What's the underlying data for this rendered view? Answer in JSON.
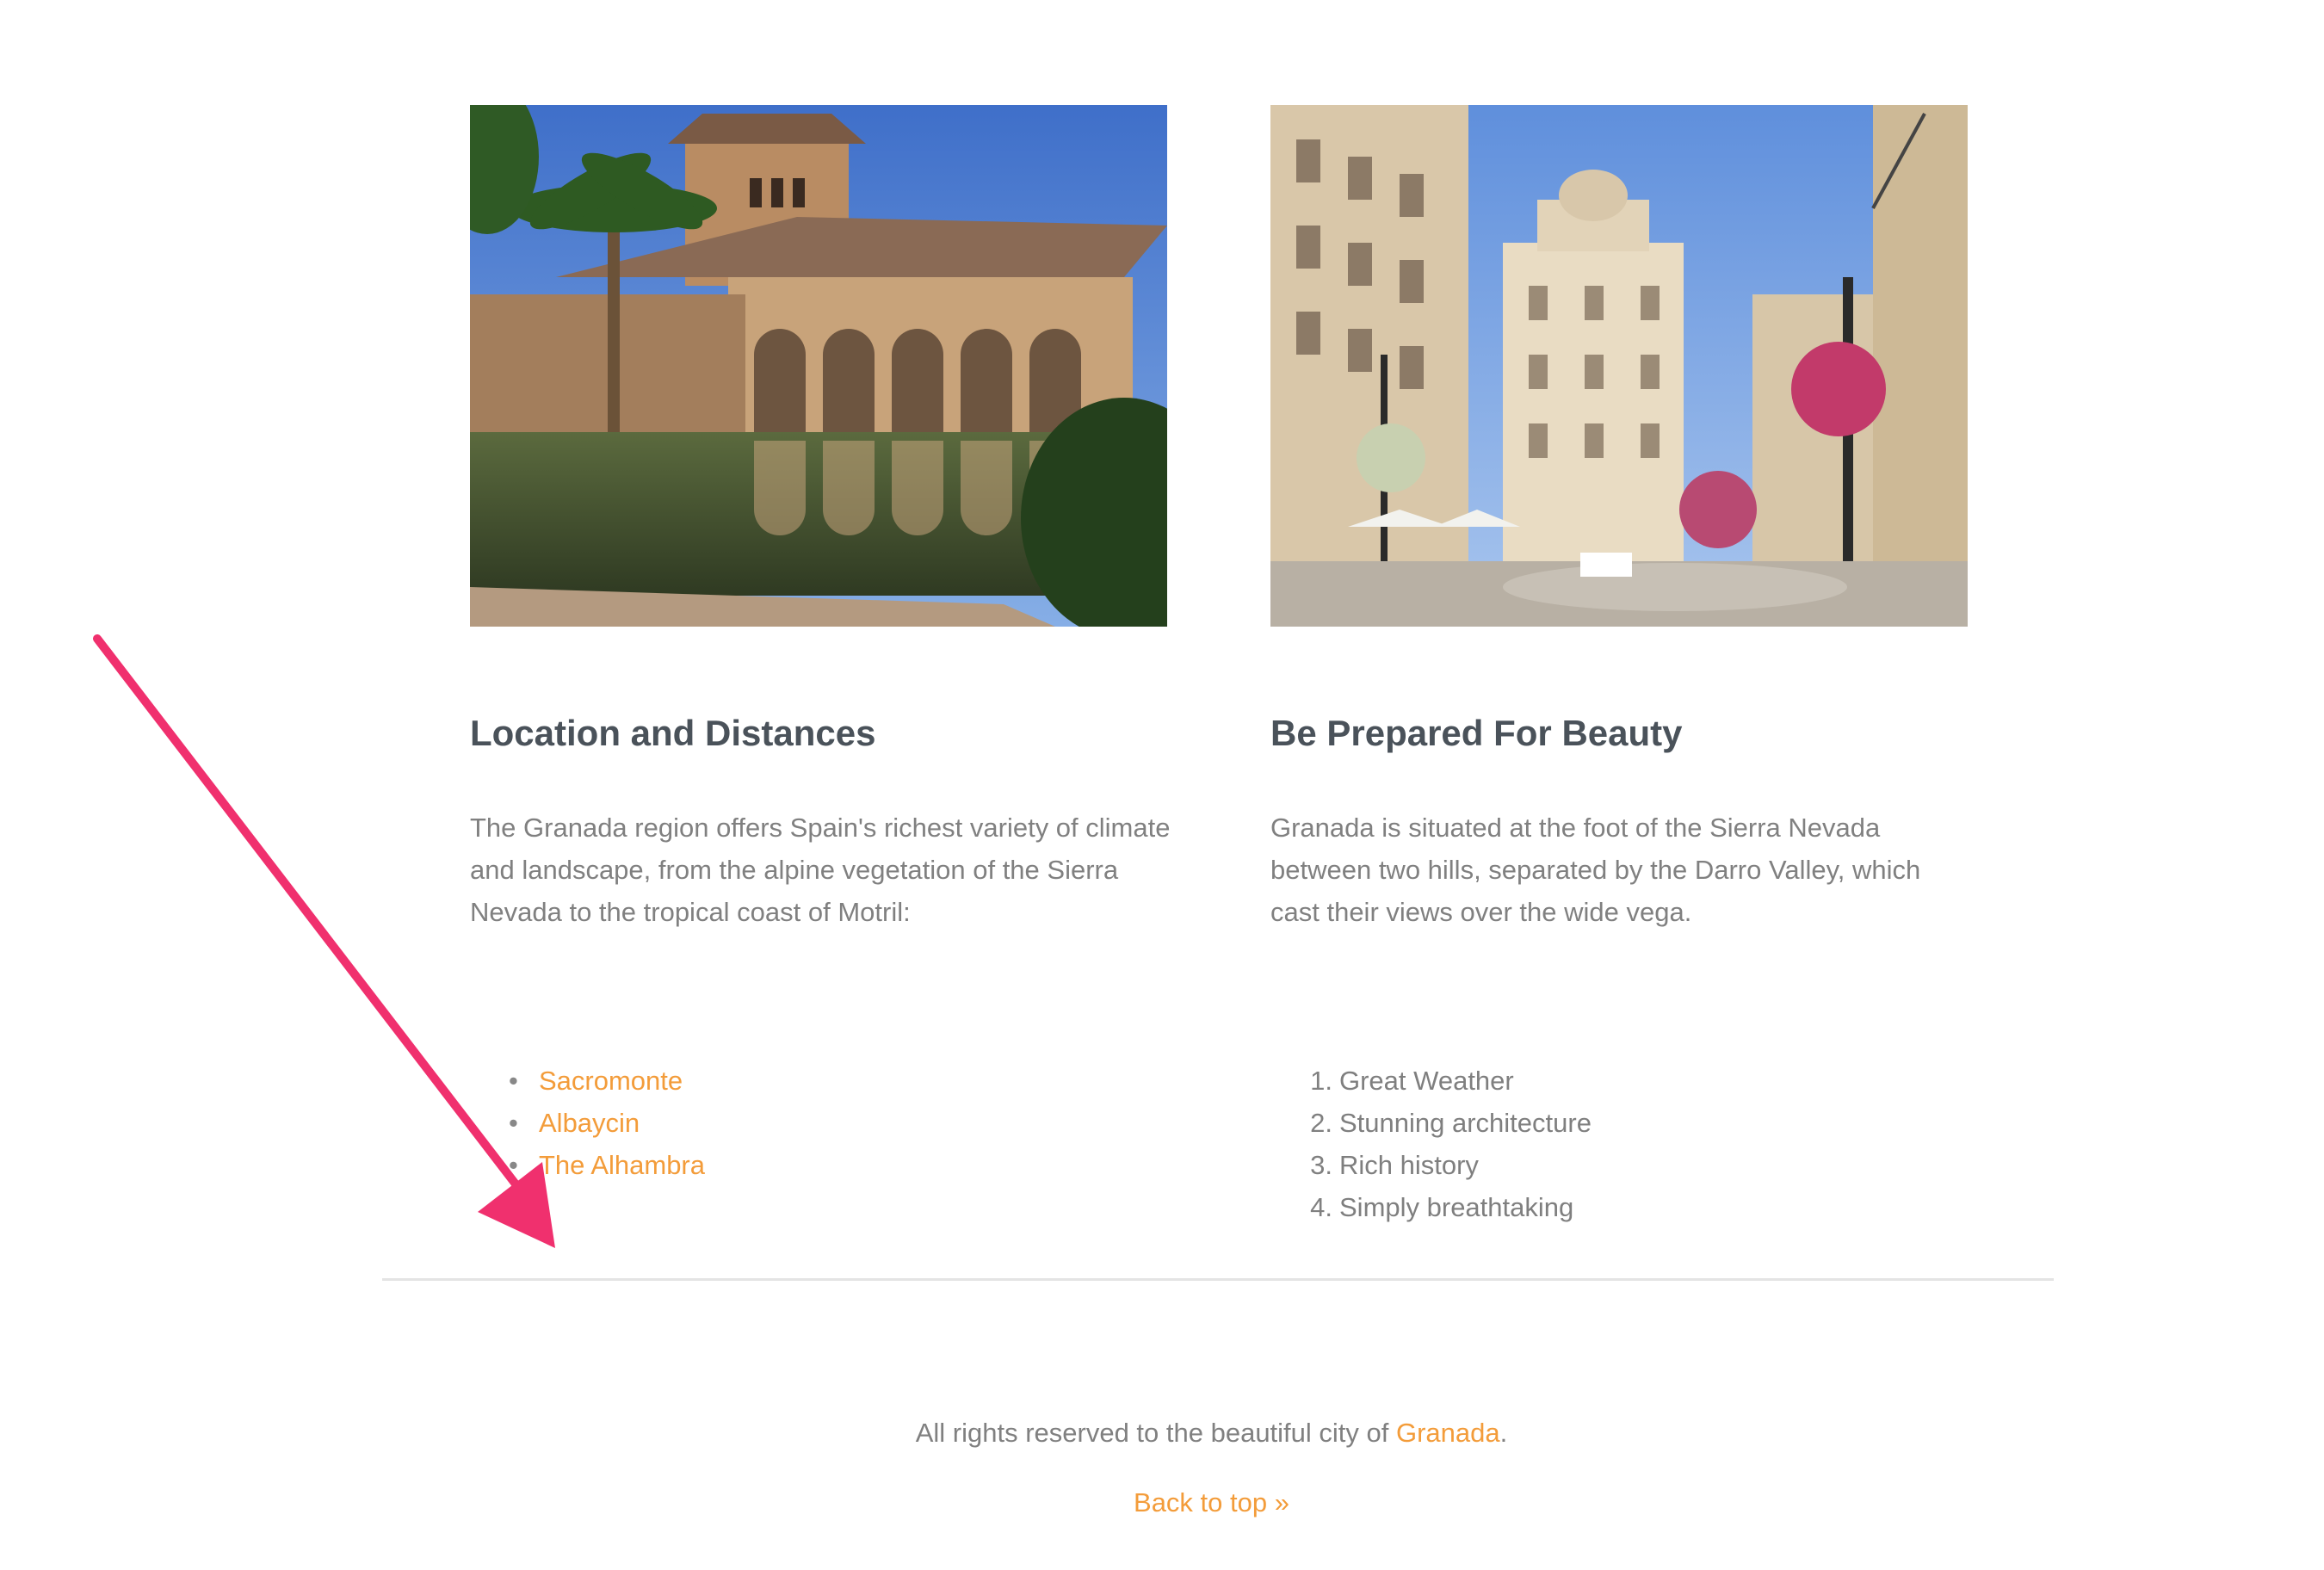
{
  "columns": [
    {
      "image": "alhambra-palace-photo",
      "heading": "Location and Distances",
      "paragraph": "The Granada region offers Spain's richest variety of climate and landscape, from the alpine vegetation of the Sierra Nevada to the tropical coast of Motril:",
      "list_type": "bulleted",
      "items": [
        "Sacromonte",
        "Albaycin",
        "The Alhambra"
      ]
    },
    {
      "image": "granada-street-photo",
      "heading": "Be Prepared For Beauty",
      "paragraph": "Granada is situated at the foot of the Sierra Nevada between two hills, separated by the Darro Valley, which cast their views over the wide vega.",
      "list_type": "numbered",
      "items": [
        {
          "num": "1.",
          "text": "Great Weather"
        },
        {
          "num": "2.",
          "text": "Stunning architecture"
        },
        {
          "num": "3.",
          "text": "Rich history"
        },
        {
          "num": "4.",
          "text": "Simply breathtaking"
        }
      ]
    }
  ],
  "footer": {
    "text_before": "All rights reserved to the beautiful city of ",
    "link": "Granada",
    "text_after": ".",
    "back_to_top": "Back to top »"
  },
  "colors": {
    "link": "#f39c3a",
    "heading": "#4a525a",
    "body": "#808080",
    "annotation_arrow": "#f0306e"
  },
  "annotation": "arrow-pointing-to-divider"
}
